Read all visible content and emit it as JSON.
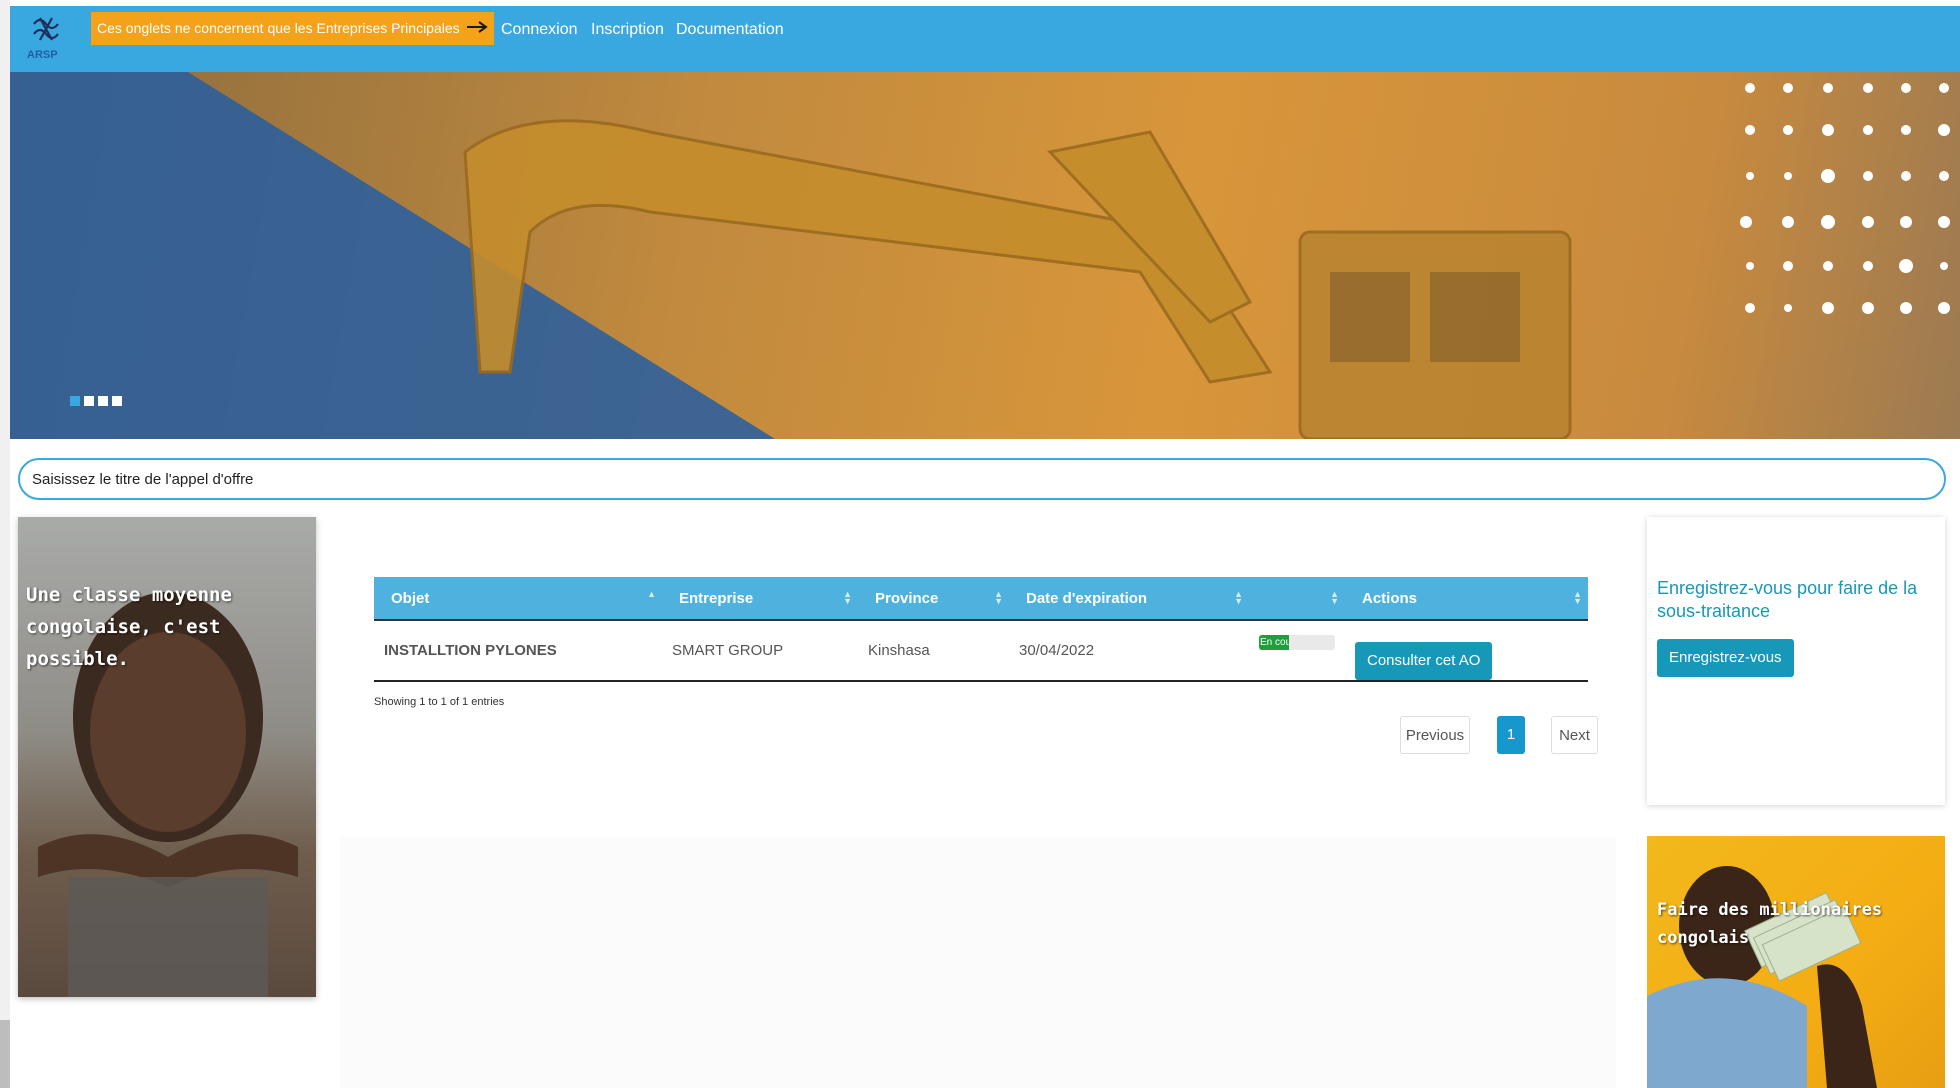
{
  "navbar": {
    "logo_text": "ARSP",
    "notice": "Ces onglets ne concernent que les Entreprises Principales",
    "links": [
      "Connexion",
      "Inscription",
      "Documentation"
    ]
  },
  "search": {
    "placeholder": "Saisissez le titre de l'appel d'offre"
  },
  "promo_left": {
    "text": "Une classe moyenne congolaise, c'est possible."
  },
  "table": {
    "columns": [
      "Objet",
      "Entreprise",
      "Province",
      "Date d'expiration",
      "",
      "Actions"
    ],
    "rows": [
      {
        "objet": "INSTALLTION PYLONES",
        "entreprise": "SMART GROUP",
        "province": "Kinshasa",
        "date": "30/04/2022",
        "status_label": "En cours",
        "status_progress": 0.4,
        "action": "Consulter cet AO"
      }
    ],
    "info": "Showing 1 to 1 of 1 entries",
    "pagination": {
      "previous": "Previous",
      "current": "1",
      "next": "Next"
    }
  },
  "subcontract_card": {
    "title": "Enregistrez-vous pour faire de la sous-traitance",
    "button": "Enregistrez-vous"
  },
  "promo_right": {
    "text": "Faire des millionaires congolais"
  },
  "colors": {
    "brand_blue": "#3aa8e0",
    "notice_orange": "#f5a21b",
    "table_header": "#4fb2de",
    "button_teal": "#1798b8",
    "status_green": "#1e9e3c"
  }
}
